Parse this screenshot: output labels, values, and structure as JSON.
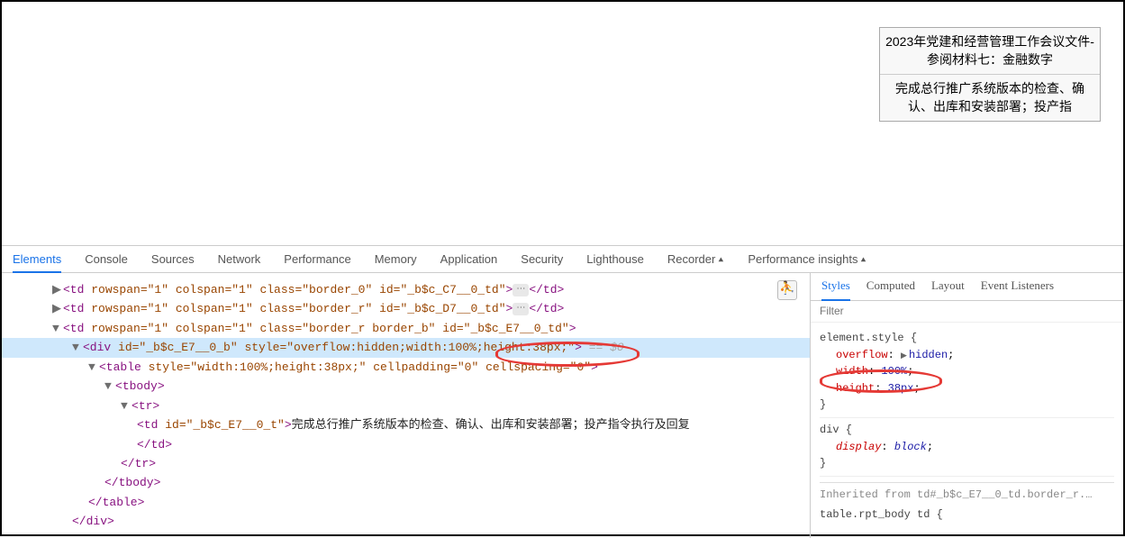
{
  "tooltip": {
    "row1": "2023年党建和经营管理工作会议文件-参阅材料七：金融数字",
    "row2": "完成总行推广系统版本的检查、确认、出库和安装部署；投产指"
  },
  "devtools_tabs": [
    "Elements",
    "Console",
    "Sources",
    "Network",
    "Performance",
    "Memory",
    "Application",
    "Security",
    "Lighthouse",
    "Recorder",
    "Performance insights"
  ],
  "active_tab": "Elements",
  "dom": {
    "line0_tag": "td",
    "line0_attrs": "rowspan=\"1\" colspan=\"1\" class=\"border_0\" id=\"_b$c_C7__0_td\"",
    "line1_tag": "td",
    "line1_attrs": "rowspan=\"1\" colspan=\"1\" class=\"border_r\" id=\"_b$c_D7__0_td\"",
    "line2_tag": "td",
    "line2_attrs": "rowspan=\"1\" colspan=\"1\" class=\"border_r border_b\" id=\"_b$c_E7__0_td\"",
    "sel_tag": "div",
    "sel_attrs_pre": "id=\"_b$c_E7__0_b\" style=\"overflow:hidden;width:100%",
    "sel_attrs_hl": ";height:38px;\"",
    "sel_marker": " == $0",
    "tbl_tag": "table",
    "tbl_attrs": "style=\"width:100%;height:38px;\" cellpadding=\"0\" cellspacing=\"0\"",
    "tbody": "tbody",
    "tr": "tr",
    "td_inner_tag": "td",
    "td_inner_attrs": "id=\"_b$c_E7__0_t\"",
    "td_inner_text": "完成总行推广系统版本的检查、确认、出库和安装部署；投产指令执行及回复",
    "close_td": "</td>",
    "close_tr": "</tr>",
    "close_tbody": "</tbody>",
    "close_table": "</table>",
    "close_div": "</div>"
  },
  "styles": {
    "tabs": [
      "Styles",
      "Computed",
      "Layout",
      "Event Listeners"
    ],
    "active": "Styles",
    "filter_placeholder": "Filter",
    "rule1_sel": "element.style {",
    "rule1_p1_name": "overflow",
    "rule1_p1_val": "hidden",
    "rule1_p2_name": "width",
    "rule1_p2_val": "100%",
    "rule1_p3_name": "height",
    "rule1_p3_val": "38px",
    "brace_close": "}",
    "rule2_sel": "div {",
    "rule2_p1_name": "display",
    "rule2_p1_val": "block",
    "inherited_label": "Inherited from ",
    "inherited_link": "td#_b$c_E7__0_td.border_r.…",
    "rule3_sel": "table.rpt_body td {"
  }
}
